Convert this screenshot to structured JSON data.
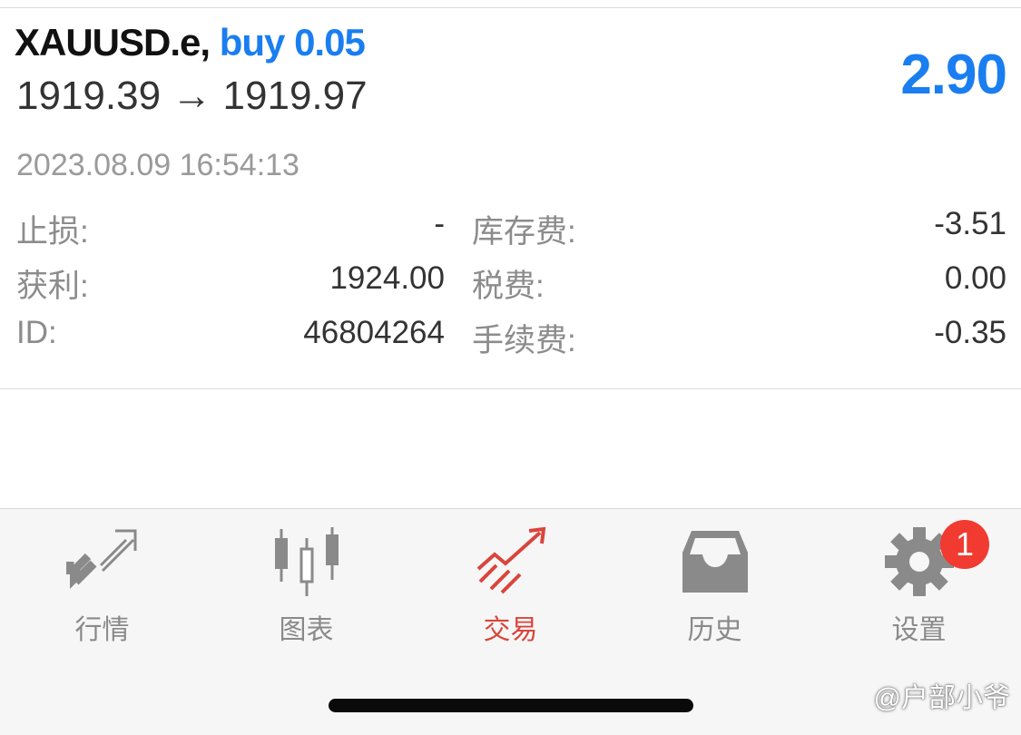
{
  "position": {
    "symbol": "XAUUSD.e,",
    "side": "buy 0.05",
    "open_price": "1919.39",
    "arrow": "→",
    "current_price": "1919.97",
    "profit": "2.90",
    "open_time": "2023.08.09 16:54:13",
    "details": {
      "sl_label": "止损:",
      "sl_value": "-",
      "tp_label": "获利:",
      "tp_value": "1924.00",
      "id_label": "ID:",
      "id_value": "46804264",
      "swap_label": "库存费:",
      "swap_value": "-3.51",
      "tax_label": "税费:",
      "tax_value": "0.00",
      "commission_label": "手续费:",
      "commission_value": "-0.35"
    }
  },
  "tabs": [
    {
      "label": "行情",
      "icon": "quotes-arrows-icon"
    },
    {
      "label": "图表",
      "icon": "chart-candles-icon"
    },
    {
      "label": "交易",
      "icon": "trade-trend-icon",
      "active": true
    },
    {
      "label": "历史",
      "icon": "history-inbox-icon"
    },
    {
      "label": "设置",
      "icon": "gear-icon",
      "badge": "1"
    }
  ],
  "watermark": "@户部小爷",
  "colors": {
    "accent_blue": "#1a7ef0",
    "active_red": "#d9453c",
    "inactive_gray": "#8a8a8a",
    "badge_red": "#f13a30"
  }
}
